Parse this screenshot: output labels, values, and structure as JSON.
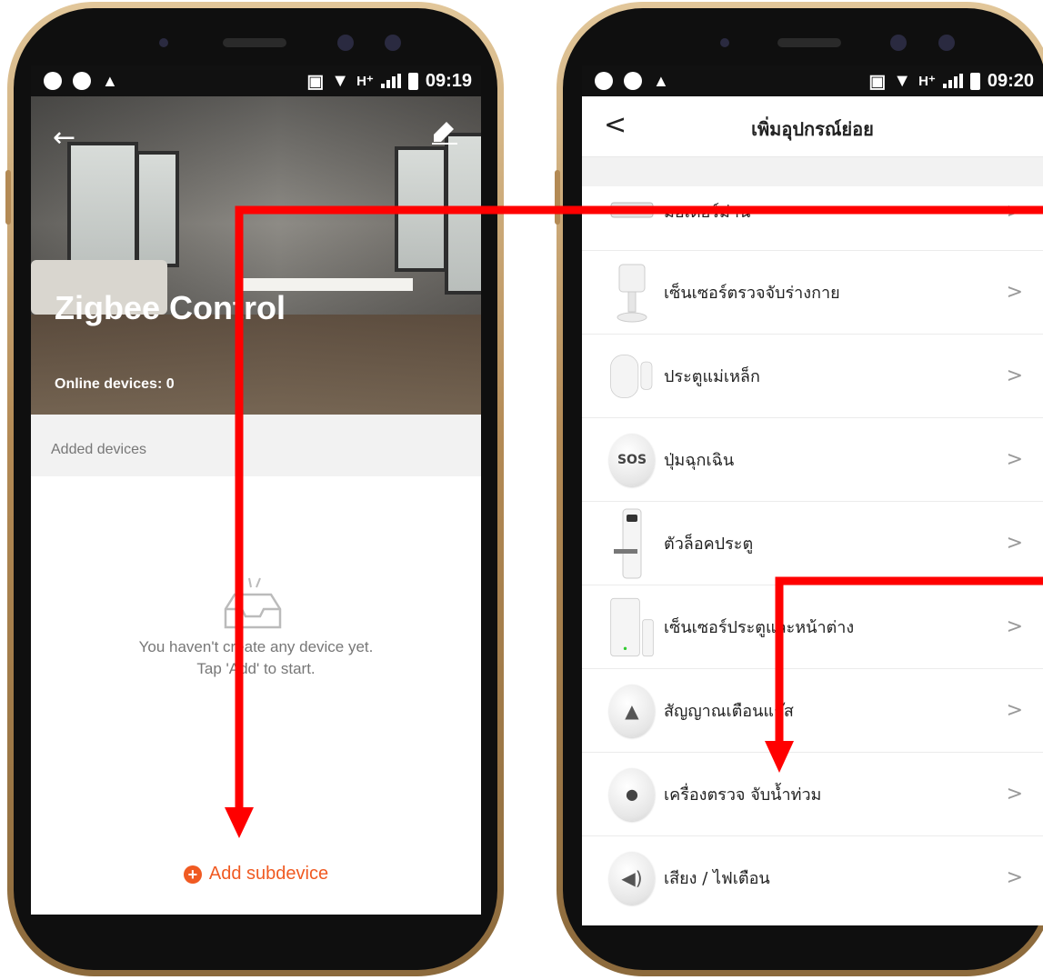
{
  "left_phone": {
    "status": {
      "time": "09:19",
      "network": "H⁺"
    },
    "title": "Zigbee Control",
    "online_devices": "Online devices: 0",
    "added_devices_label": "Added devices",
    "empty_line1": "You haven't create any device yet.",
    "empty_line2": "Tap 'Add' to start.",
    "add_subdevice": "Add subdevice"
  },
  "right_phone": {
    "status": {
      "time": "09:20",
      "network": "H⁺"
    },
    "title": "เพิ่มอุปกรณ์ย่อย",
    "items": [
      {
        "label": "มอเตอร์ม่าน",
        "icon": "curtain-motor-icon"
      },
      {
        "label": "เซ็นเซอร์ตรวจจับร่างกาย",
        "icon": "motion-sensor-icon"
      },
      {
        "label": "ประตูแม่เหล็ก",
        "icon": "door-magnet-icon"
      },
      {
        "label": "ปุ่มฉุกเฉิน",
        "icon": "sos-button-icon",
        "badge": "SOS"
      },
      {
        "label": "ตัวล็อคประตู",
        "icon": "door-lock-icon"
      },
      {
        "label": "เซ็นเซอร์ประตูและหน้าต่าง",
        "icon": "door-window-sensor-icon"
      },
      {
        "label": "สัญญาณเตือนแก๊ส",
        "icon": "gas-alarm-icon"
      },
      {
        "label": "เครื่องตรวจ จับน้ำท่วม",
        "icon": "flood-detector-icon"
      },
      {
        "label": "เสียง / ไฟเตือน",
        "icon": "siren-icon"
      }
    ]
  },
  "colors": {
    "accent": "#f05a22",
    "arrow": "#ff0000"
  }
}
